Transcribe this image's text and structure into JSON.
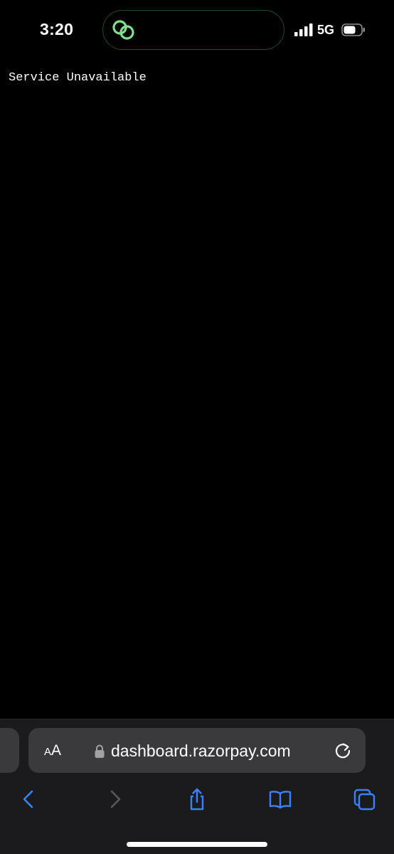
{
  "status_bar": {
    "time": "3:20",
    "network": "5G",
    "island_accent_color": "#7ee08a",
    "icons": [
      "signal-bars-icon",
      "battery-icon",
      "linked-rings-icon"
    ]
  },
  "page": {
    "message": "Service Unavailable"
  },
  "browser": {
    "reader_small_a": "A",
    "reader_large_a": "A",
    "url": "dashboard.razorpay.com",
    "accent_color": "#3a82f7",
    "disabled_color": "#5a5a5e",
    "toolbar": [
      "back",
      "forward",
      "share",
      "bookmarks",
      "tabs"
    ]
  }
}
